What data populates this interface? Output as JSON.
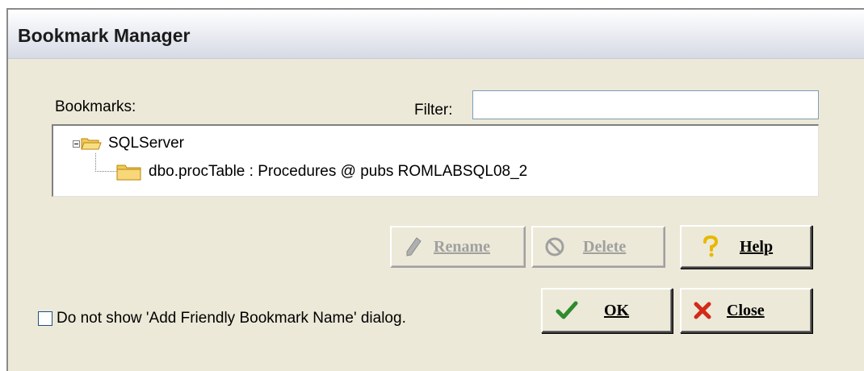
{
  "window": {
    "title": "Bookmark Manager"
  },
  "bookmarks_label": "Bookmarks:",
  "filter": {
    "label": "Filter:",
    "value": "",
    "placeholder": ""
  },
  "tree": {
    "root": {
      "label": "SQLServer",
      "icon": "folder-open-icon",
      "expanded": true
    },
    "children": [
      {
        "label": "dbo.procTable : Procedures @ pubs ROMLABSQL08_2",
        "icon": "folder-icon"
      }
    ]
  },
  "buttons": {
    "rename": {
      "label": "Rename",
      "icon": "pencil-icon",
      "enabled": false
    },
    "delete": {
      "label": "Delete",
      "icon": "no-entry-icon",
      "enabled": false
    },
    "help": {
      "label": "Help",
      "icon": "question-mark-icon",
      "enabled": true
    },
    "ok": {
      "label": "OK",
      "icon": "checkmark-icon",
      "enabled": true
    },
    "close": {
      "label": "Close",
      "icon": "red-x-icon",
      "enabled": true
    }
  },
  "checkbox": {
    "label": "Do not show 'Add Friendly Bookmark Name' dialog.",
    "checked": false
  },
  "colors": {
    "window_bg": "#ece9d8",
    "checkmark": "#2e8b2e",
    "close_x": "#d32a1a",
    "help": "#e8b800"
  }
}
